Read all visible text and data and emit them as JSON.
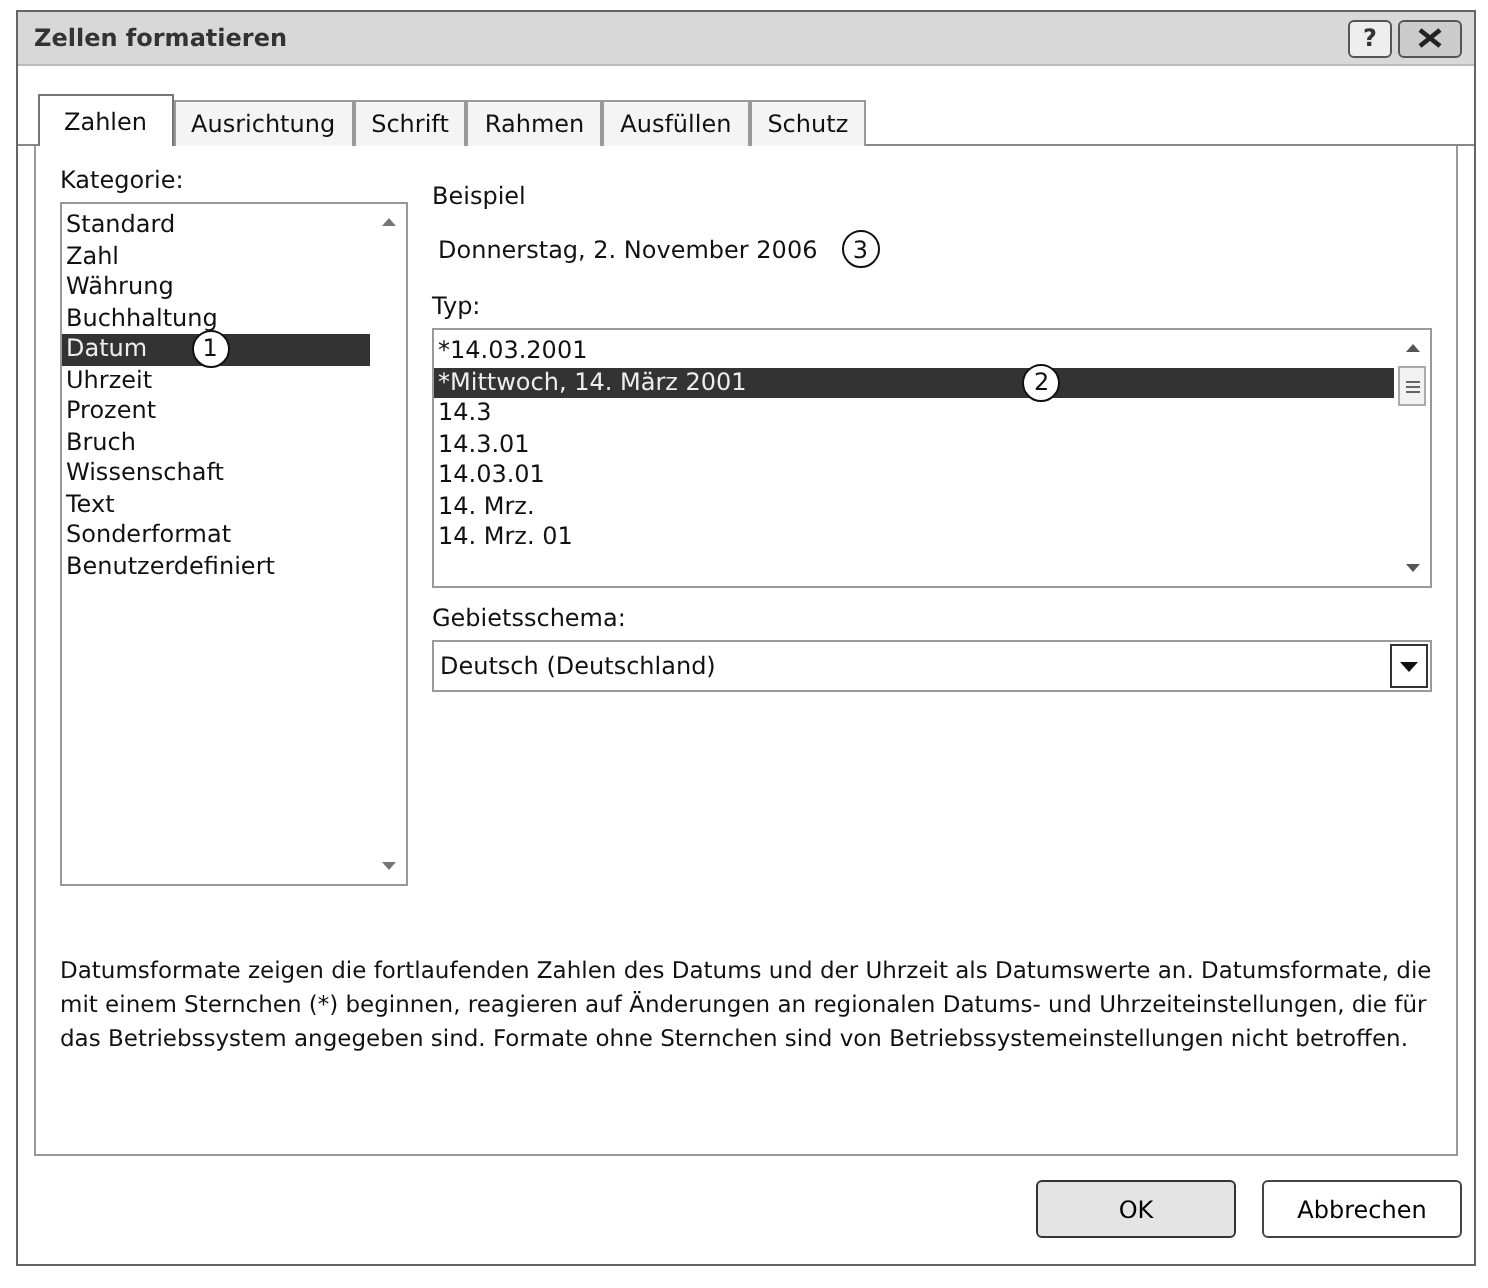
{
  "window": {
    "title": "Zellen formatieren"
  },
  "title_buttons": [
    {
      "kind": "help",
      "label": "?"
    },
    {
      "kind": "close"
    }
  ],
  "tabs": [
    {
      "label": "Zahlen",
      "selected": true
    },
    {
      "label": "Ausrichtung",
      "selected": false
    },
    {
      "label": "Schrift",
      "selected": false
    },
    {
      "label": "Rahmen",
      "selected": false
    },
    {
      "label": "Ausfüllen",
      "selected": false
    },
    {
      "label": "Schutz",
      "selected": false
    }
  ],
  "category": {
    "label": "Kategorie:",
    "items": [
      {
        "label": "Standard",
        "selected": false
      },
      {
        "label": "Zahl",
        "selected": false
      },
      {
        "label": "Währung",
        "selected": false
      },
      {
        "label": "Buchhaltung",
        "selected": false
      },
      {
        "label": "Datum",
        "selected": true,
        "callout": "1"
      },
      {
        "label": "Uhrzeit",
        "selected": false
      },
      {
        "label": "Prozent",
        "selected": false
      },
      {
        "label": "Bruch",
        "selected": false
      },
      {
        "label": "Wissenschaft",
        "selected": false
      },
      {
        "label": "Text",
        "selected": false
      },
      {
        "label": "Sonderformat",
        "selected": false
      },
      {
        "label": "Benutzerdefiniert",
        "selected": false
      }
    ]
  },
  "sample": {
    "label": "Beispiel",
    "value": "Donnerstag, 2. November 2006",
    "callout": "3"
  },
  "type": {
    "label": "Typ:",
    "items": [
      {
        "label": "*14.03.2001",
        "selected": false
      },
      {
        "label": "*Mittwoch, 14. März 2001",
        "selected": true,
        "callout": "2"
      },
      {
        "label": "14.3",
        "selected": false
      },
      {
        "label": "14.3.01",
        "selected": false
      },
      {
        "label": "14.03.01",
        "selected": false
      },
      {
        "label": "14. Mrz.",
        "selected": false
      },
      {
        "label": "14. Mrz. 01",
        "selected": false
      }
    ]
  },
  "locale": {
    "label": "Gebietsschema:",
    "value": "Deutsch (Deutschland)"
  },
  "description": "Datumsformate zeigen die fortlaufenden Zahlen des Datums und der Uhrzeit als Datumswerte an. Datumsformate, die mit einem Sternchen (*) beginnen, reagieren auf Änderungen an regionalen Datums- und Uhrzeiteinstellungen, die für das Betriebssystem angegeben sind. Formate ohne Sternchen sind von Betriebssystemeinstellungen nicht betroffen.",
  "buttons": [
    {
      "label": "OK",
      "kind": "default"
    },
    {
      "label": "Abbrechen",
      "kind": "normal"
    }
  ]
}
